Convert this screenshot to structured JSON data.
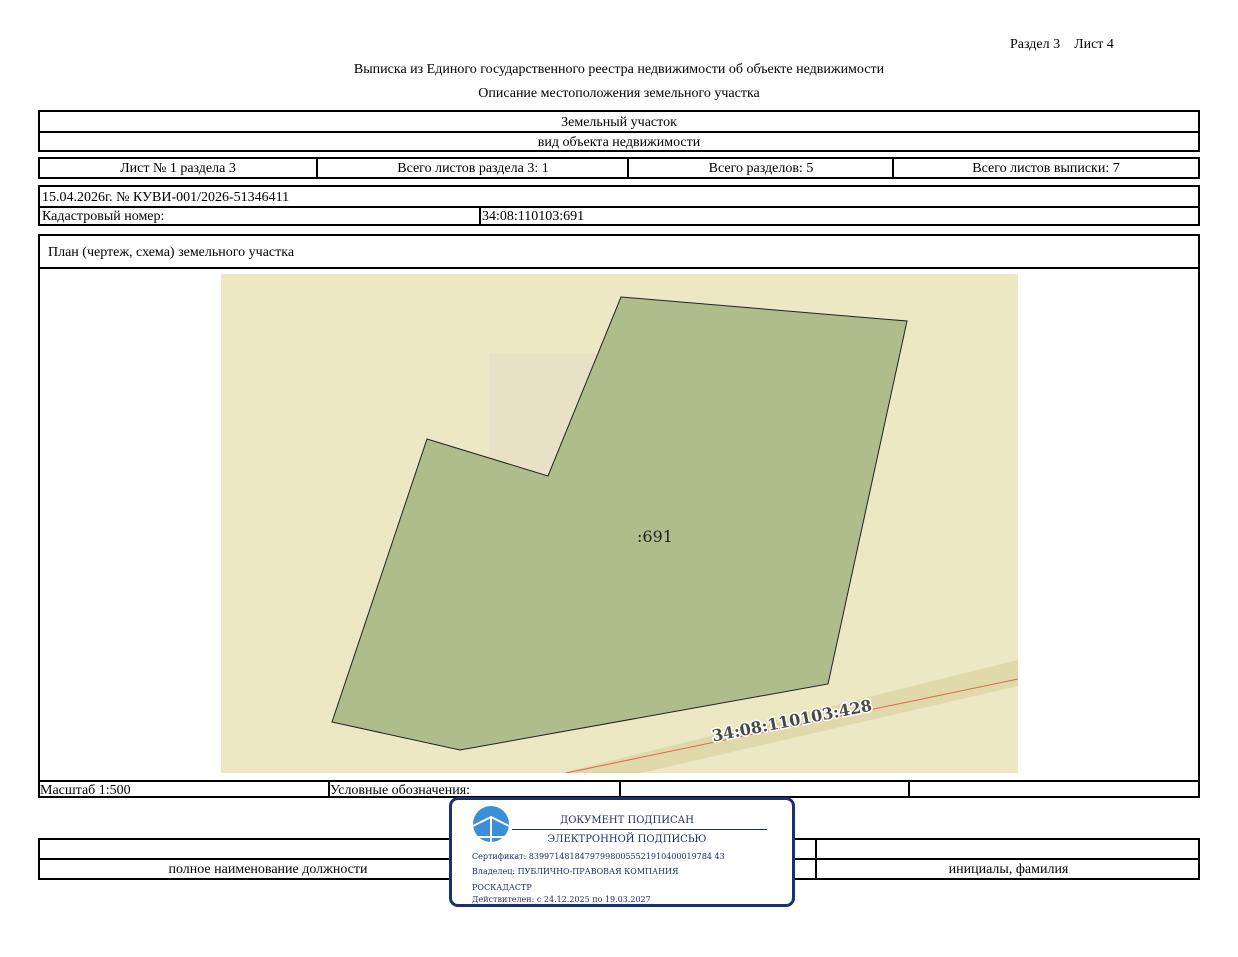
{
  "header": {
    "section_sheet": "Раздел 3    Лист 4",
    "title": "Выписка из Единого государственного реестра недвижимости об объекте недвижимости",
    "subtitle": "Описание местоположения земельного участка"
  },
  "object": {
    "type": "Земельный участок",
    "type_caption": "вид объекта недвижимости"
  },
  "sheets": {
    "sheet_no": "Лист № 1 раздела 3",
    "section_sheets": "Всего листов раздела 3: 1",
    "total_sections": "Всего разделов: 5",
    "total_sheets": "Всего листов выписки: 7"
  },
  "record": {
    "date_number": "15.04.2026г. № КУВИ-001/2026-51346411",
    "cadastral_label": "Кадастровый номер:",
    "cadastral_value": "34:08:110103:691"
  },
  "plan": {
    "title": "План (чертеж, схема) земельного участка",
    "parcel_label": ":691",
    "neighbor_label": "34:08:110103:428",
    "colors": {
      "background": "#ece8c4",
      "parcel_fill": "#afbd8c",
      "road_band": "#e0d9ac",
      "boundary_line": "#e8604c"
    }
  },
  "legend": {
    "scale": "Масштаб 1:500",
    "symbols_label": "Условные обозначения:"
  },
  "signature": {
    "position_caption": "полное наименование должности",
    "name_caption": "инициалы, фамилия"
  },
  "stamp": {
    "line1": "ДОКУМЕНТ ПОДПИСАН",
    "line2": "ЭЛЕКТРОННОЙ ПОДПИСЬЮ",
    "certificate": "Сертификат: 839971481847979980055521910400019784 43",
    "owner_line1": "Владелец: ПУБЛИЧНО-ПРАВОВАЯ КОМПАНИЯ",
    "owner_line2": "РОСКАДАСТР",
    "validity": "Действителен: с 24.12.2025 по 19.03.2027",
    "color": "#1c2f6e",
    "logo_color": "#3a8fd8"
  }
}
